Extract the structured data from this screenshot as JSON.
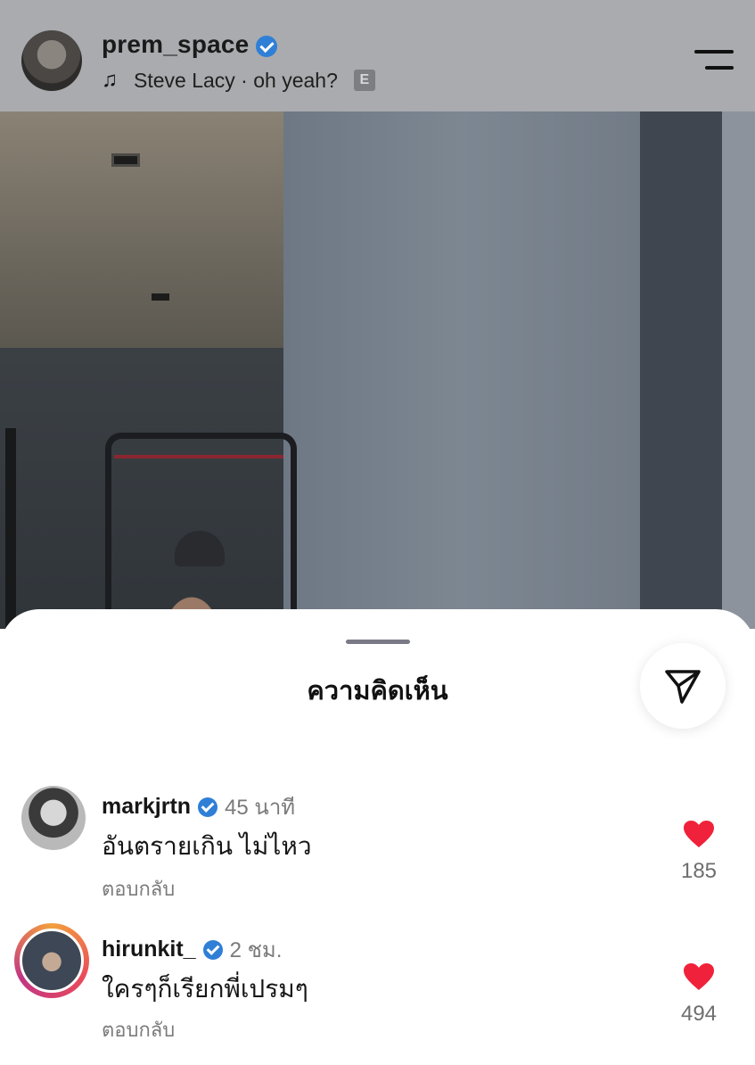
{
  "post": {
    "username": "prem_space",
    "verified": true,
    "music": {
      "artist_song": "Steve Lacy · oh yeah?",
      "explicit_badge": "E",
      "icon": "music-note-icon"
    },
    "menu_icon": "hamburger-menu-icon"
  },
  "comments_sheet": {
    "title": "ความคิดเห็น",
    "share_icon": "send-plane-icon",
    "comments": [
      {
        "username": "markjrtn",
        "verified": true,
        "time": "45 นาที",
        "text": "อันตรายเกิน ไม่ไหว",
        "reply_label": "ตอบกลับ",
        "likes": "185",
        "liked": true
      },
      {
        "username": "hirunkit_",
        "verified": true,
        "time": "2 ชม.",
        "text": "ใครๆก็เรียกพี่เปรมๆ",
        "reply_label": "ตอบกลับ",
        "likes": "494",
        "liked": true
      }
    ]
  },
  "colors": {
    "verified_blue": "#2f7fd6",
    "heart_red": "#f0213a"
  }
}
